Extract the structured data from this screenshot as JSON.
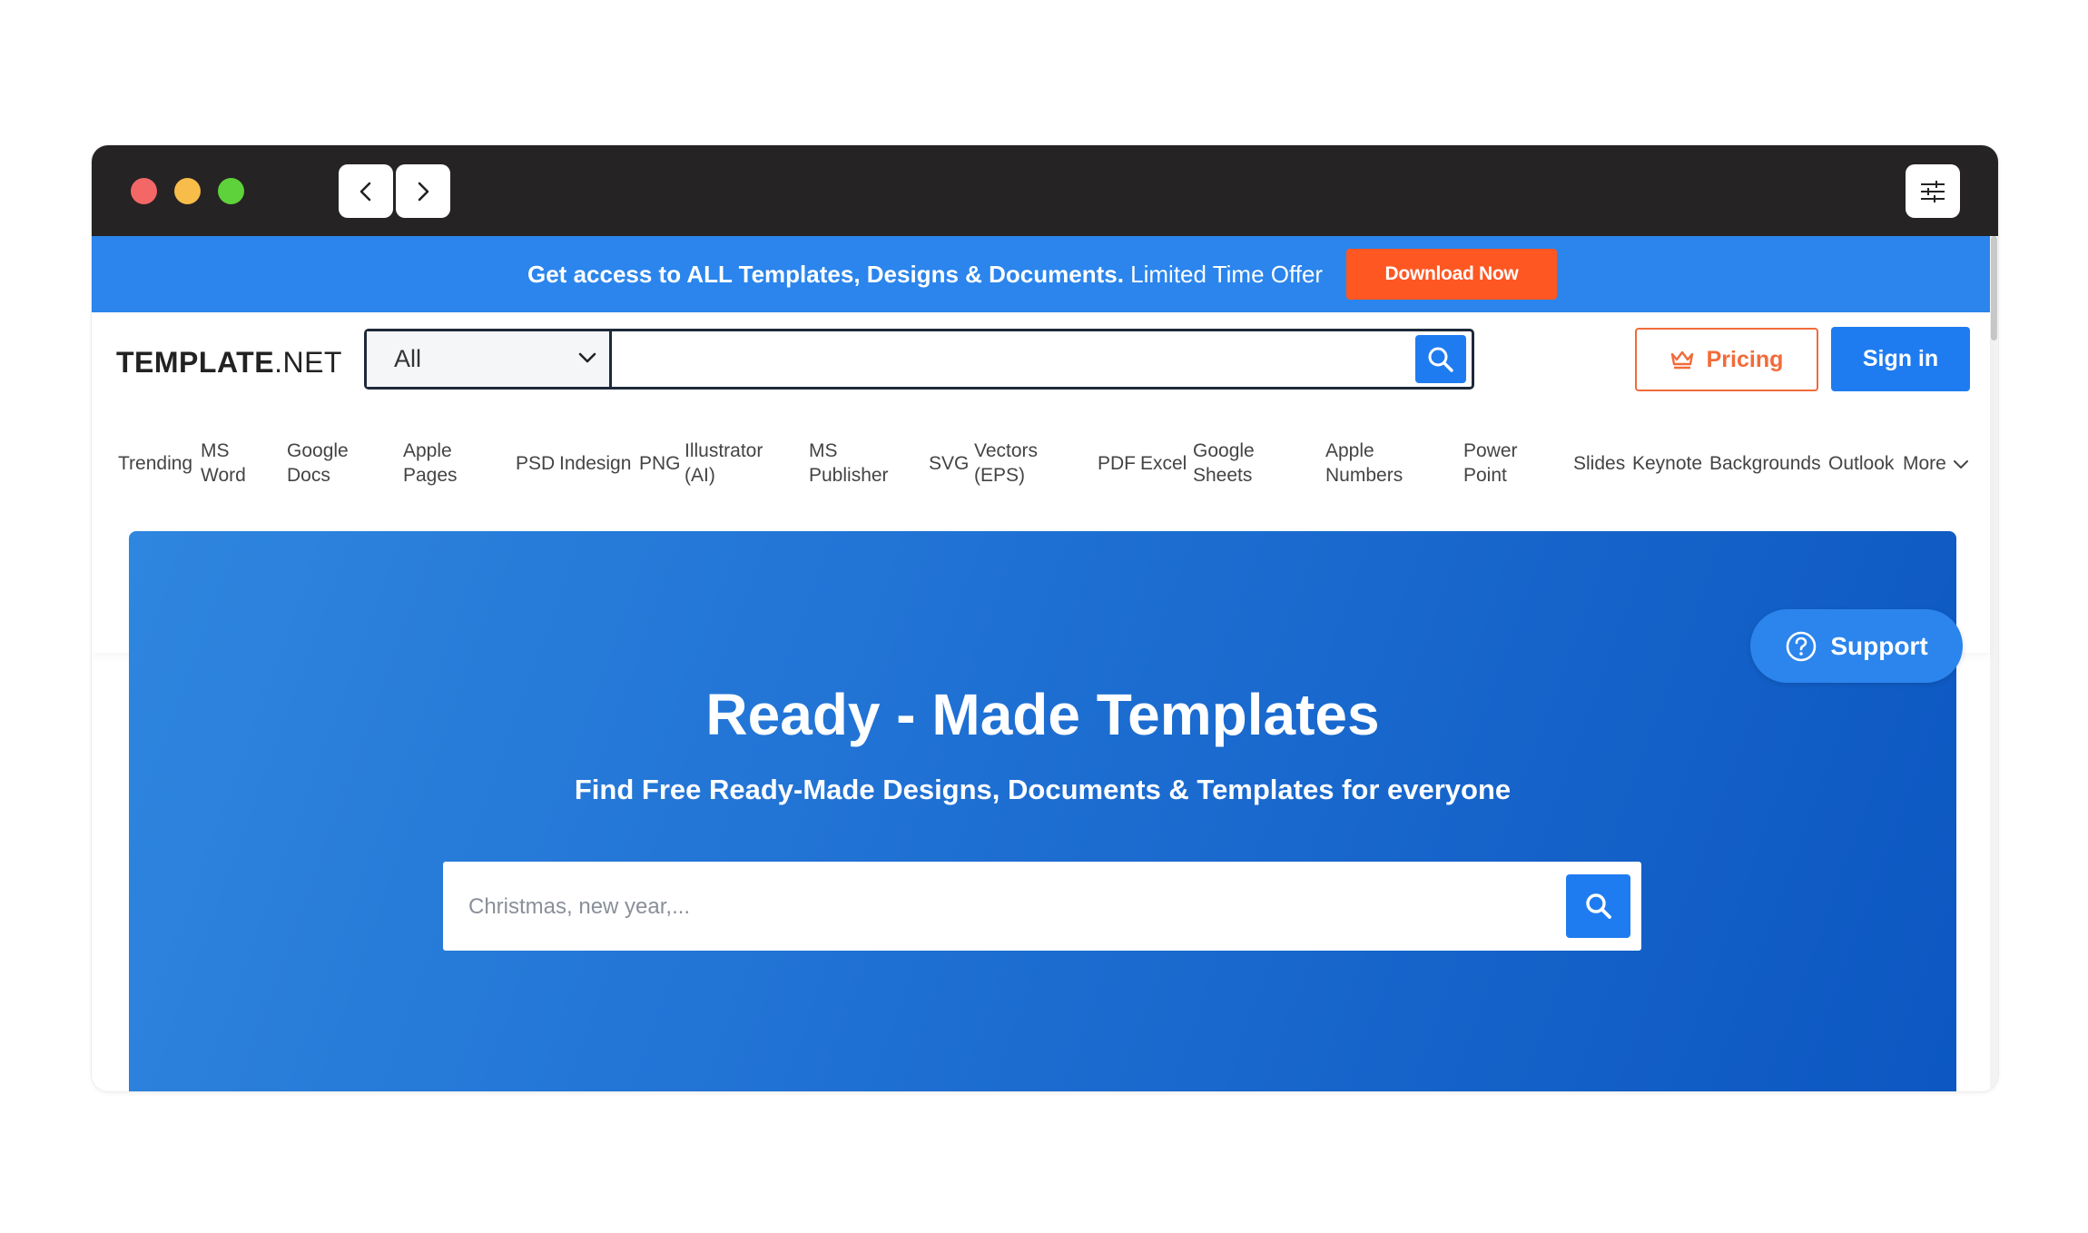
{
  "promo": {
    "bold_text": "Get access to ALL Templates, Designs & Documents.",
    "regular_text": " Limited Time Offer",
    "button_label": "Download Now"
  },
  "header": {
    "logo_bold": "TEMPLATE",
    "logo_regular": ".NET",
    "search_category": "All",
    "search_value": "",
    "pricing_label": "Pricing",
    "signin_label": "Sign in"
  },
  "categories": {
    "trending": "Trending",
    "ms_word_1": "MS",
    "ms_word_2": "Word",
    "google_docs_1": "Google",
    "google_docs_2": "Docs",
    "apple_pages_1": "Apple",
    "apple_pages_2": "Pages",
    "psd": "PSD",
    "indesign": "Indesign",
    "png": "PNG",
    "illustrator_1": "Illustrator",
    "illustrator_2": "(AI)",
    "ms_publisher_1": "MS",
    "ms_publisher_2": "Publisher",
    "svg": "SVG",
    "vectors_1": "Vectors",
    "vectors_2": "(EPS)",
    "pdf": "PDF",
    "excel": "Excel",
    "google_sheets_1": "Google",
    "google_sheets_2": "Sheets",
    "apple_numbers_1": "Apple",
    "apple_numbers_2": "Numbers",
    "power_point_1": "Power",
    "power_point_2": "Point",
    "slides": "Slides",
    "keynote": "Keynote",
    "backgrounds": "Backgrounds",
    "outlook": "Outlook",
    "more": "More"
  },
  "hero": {
    "title": "Ready - Made Templates",
    "subtitle": "Find Free Ready-Made Designs, Documents & Templates for everyone",
    "search_placeholder": "Christmas, new year,..."
  },
  "support": {
    "label": "Support"
  },
  "colors": {
    "brand_blue": "#1f7cf0",
    "promo_blue": "#2b85ec",
    "download_orange": "#ff5722",
    "pricing_orange": "#f26b3a",
    "titlebar": "#262324"
  },
  "icons": {
    "window_controls": [
      "close-dot",
      "minimize-dot",
      "maximize-dot"
    ],
    "nav": [
      "chevron-left-icon",
      "chevron-right-icon"
    ],
    "settings": "sliders-icon",
    "search": "search-icon",
    "pricing": "crown-icon",
    "support": "question-circle-icon",
    "dropdown": "chevron-down-icon"
  }
}
